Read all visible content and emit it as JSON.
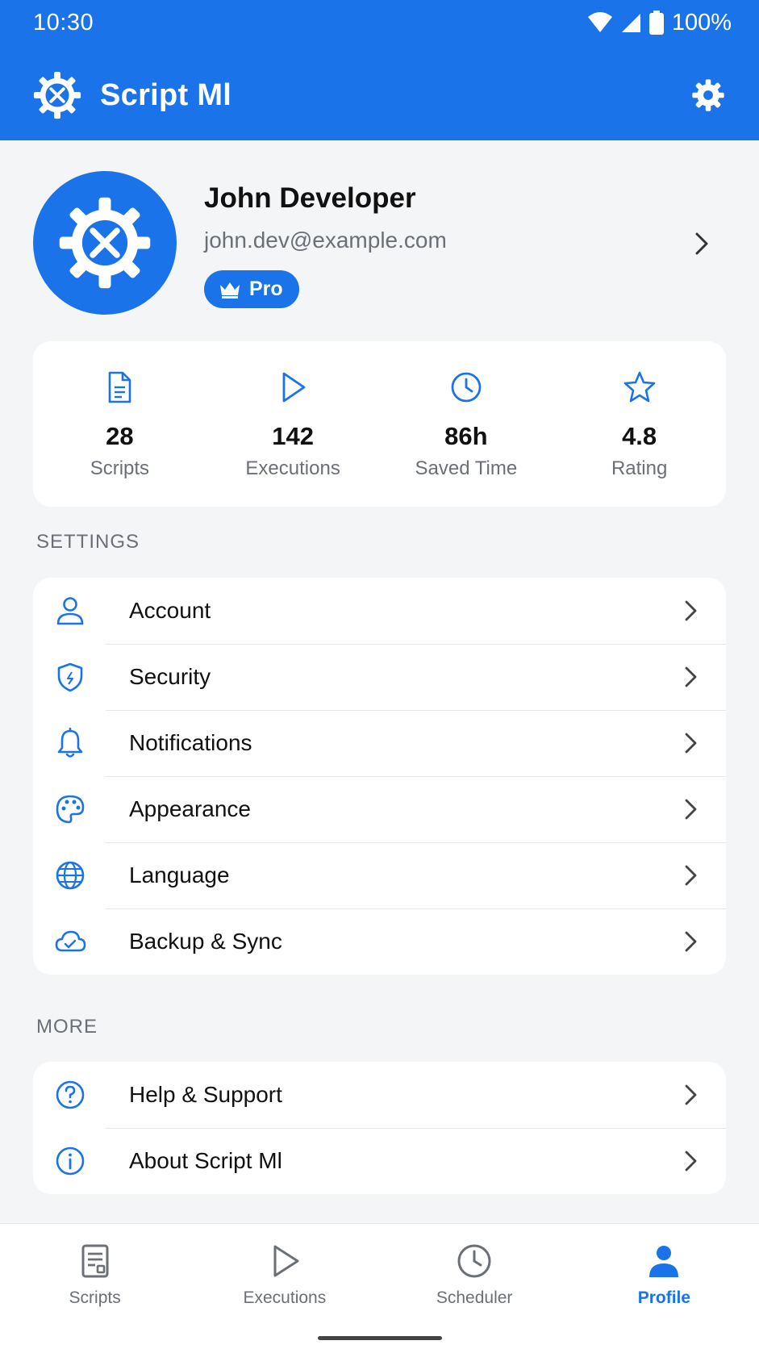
{
  "status_bar": {
    "time": "10:30",
    "battery": "100%"
  },
  "app_bar": {
    "title": "Script Ml",
    "logo_icon": "gear-tools-icon",
    "settings_icon": "gear-icon"
  },
  "profile": {
    "name": "John Developer",
    "email": "john.dev@example.com",
    "badge": "Pro",
    "badge_icon": "crown-icon"
  },
  "stats": [
    {
      "icon": "document-icon",
      "value": "28",
      "label": "Scripts"
    },
    {
      "icon": "play-icon",
      "value": "142",
      "label": "Executions"
    },
    {
      "icon": "clock-icon",
      "value": "86h",
      "label": "Saved Time"
    },
    {
      "icon": "star-icon",
      "value": "4.8",
      "label": "Rating"
    }
  ],
  "settings": {
    "header": "SETTINGS",
    "items": [
      {
        "icon": "person-icon",
        "label": "Account"
      },
      {
        "icon": "shield-icon",
        "label": "Security"
      },
      {
        "icon": "bell-icon",
        "label": "Notifications"
      },
      {
        "icon": "palette-icon",
        "label": "Appearance"
      },
      {
        "icon": "globe-icon",
        "label": "Language"
      },
      {
        "icon": "cloud-sync-icon",
        "label": "Backup & Sync"
      }
    ]
  },
  "more": {
    "header": "MORE",
    "items": [
      {
        "icon": "help-icon",
        "label": "Help & Support"
      },
      {
        "icon": "info-icon",
        "label": "About Script Ml"
      }
    ]
  },
  "bottom_nav": [
    {
      "icon": "script-icon",
      "label": "Scripts",
      "active": false
    },
    {
      "icon": "play-icon",
      "label": "Executions",
      "active": false
    },
    {
      "icon": "clock-icon",
      "label": "Scheduler",
      "active": false
    },
    {
      "icon": "person-icon",
      "label": "Profile",
      "active": true
    }
  ],
  "colors": {
    "primary": "#1a73e8",
    "background": "#f4f5f7",
    "muted_text": "#6b6f76"
  }
}
